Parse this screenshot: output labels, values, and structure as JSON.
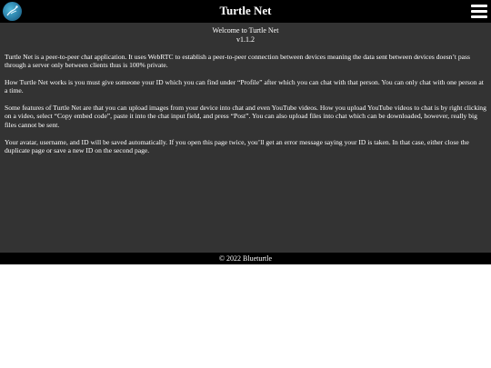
{
  "header": {
    "title": "Turtle Net",
    "logo_icon": "turtle-logo-icon",
    "menu_icon": "hamburger-menu-icon"
  },
  "main": {
    "welcome": "Welcome to Turtle Net",
    "version": "v1.1.2",
    "paragraphs": [
      "Turtle Net is a peer-to-peer chat application. It uses WebRTC to establish a peer-to-peer connection between devices meaning the data sent between devices doesn’t pass through a server only between clients thus is 100% private.",
      "How Turtle Net works is you must give someone your ID which you can find under “Profile” after which you can chat with that person. You can only chat with one person at a time.",
      "Some features of Turtle Net are that you can upload images from your device into chat and even YouTube videos. How you upload YouTube videos to chat is by right clicking on a video, select “Copy embed code”, paste it into the chat input field, and press “Post”. You can also upload files into chat which can be downloaded, however, really big files cannot be sent.",
      "Your avatar, username, and ID will be saved automatically. If you open this page twice, you’ll get an error message saying your ID is taken. In that case, either close the duplicate page or save a new ID on the second page."
    ]
  },
  "footer": {
    "copyright": "© 2022 Blueturtle"
  },
  "colors": {
    "header_bg": "#000000",
    "main_bg": "#333333",
    "footer_bg": "#000000",
    "page_bg": "#ffffff",
    "text": "#ffffff"
  }
}
